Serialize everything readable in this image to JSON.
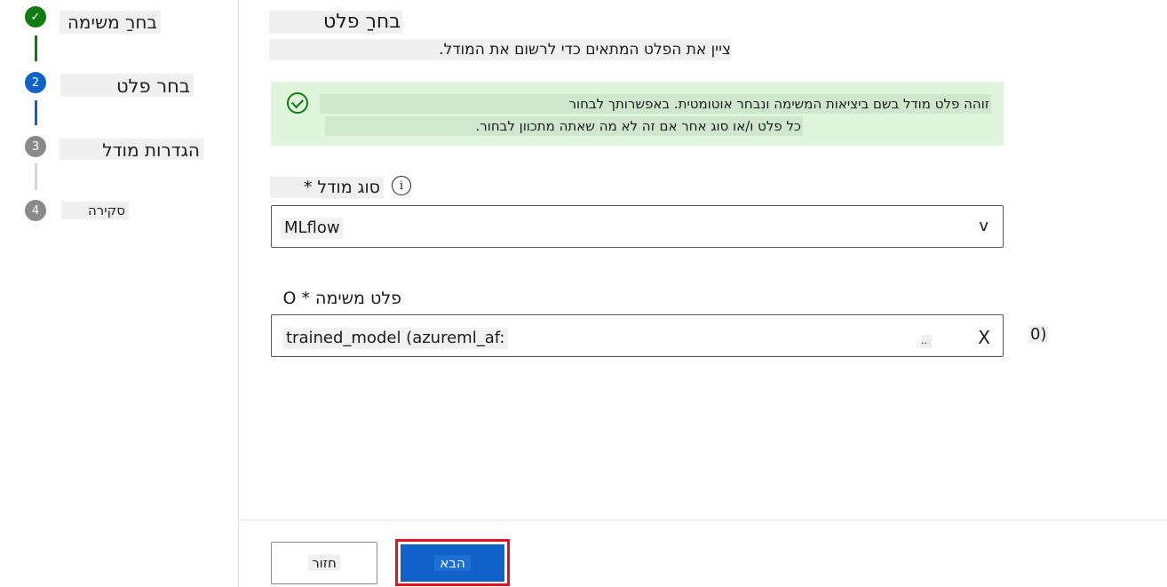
{
  "steps": [
    {
      "number": "✓",
      "label": "בחרַ משימה",
      "state": "complete",
      "color": "#107c10"
    },
    {
      "number": "2",
      "label": "בחר פלט",
      "state": "current",
      "color": "#0f62c7"
    },
    {
      "number": "3",
      "label": "הגדרות מודל",
      "state": "pending",
      "color": "#8a8a8a"
    },
    {
      "number": "4",
      "label": "סקירה",
      "state": "pending",
      "color": "#8a8a8a"
    }
  ],
  "main": {
    "title": "בחרַ פלט",
    "subtitle": "ציין את הפלט המתאים כדי לרשום את המודל.",
    "banner": {
      "line1": "זוהה פלט מודל בשם ביציאות המשימה ונבחר אוטומטית. באפשרותך לבחור",
      "line2": "כל פלט ו/או סוג אחר אם זה לא מה שאתה מתכוון לבחור.",
      "icon": "check-circle-icon",
      "color": "#dff6dd"
    },
    "model_type": {
      "label": "סוג מודל *",
      "info_icon": "i",
      "value": "MLflow",
      "chevron": "v"
    },
    "job_output": {
      "label": "פלט משימה * O",
      "value": "trained_model (azureml_af:",
      "ellipsis": "..",
      "clear": "X",
      "extra": "0)"
    }
  },
  "footer": {
    "back_label": "חזור",
    "next_label": "הבא"
  }
}
